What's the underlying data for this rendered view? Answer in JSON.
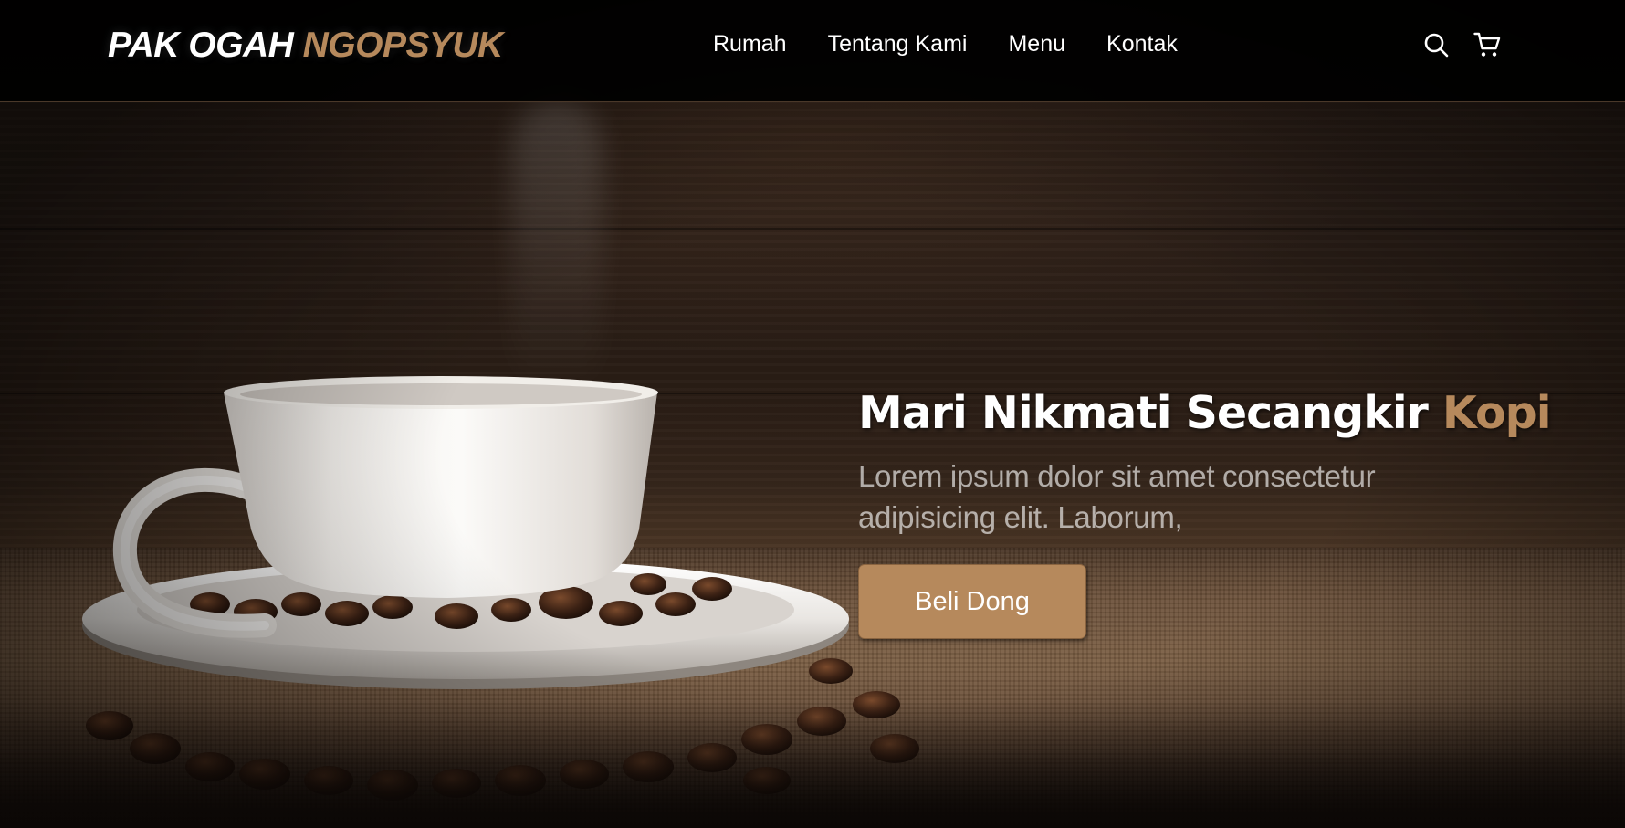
{
  "brand": {
    "name_primary": "PAK OGAH",
    "name_accent": "NGOPSYUK"
  },
  "nav": {
    "links": [
      "Rumah",
      "Tentang Kami",
      "Menu",
      "Kontak"
    ],
    "icons": [
      "search-icon",
      "shopping-cart-icon"
    ]
  },
  "hero": {
    "title_primary": "Mari Nikmati Secangkir",
    "title_accent": "Kopi",
    "description": "Lorem ipsum dolor sit amet consectetur adipisicing elit. Laborum,",
    "cta_label": "Beli Dong"
  },
  "colors": {
    "accent": "#b6895c",
    "navbar_bg": "#000000",
    "text": "#ffffff"
  }
}
